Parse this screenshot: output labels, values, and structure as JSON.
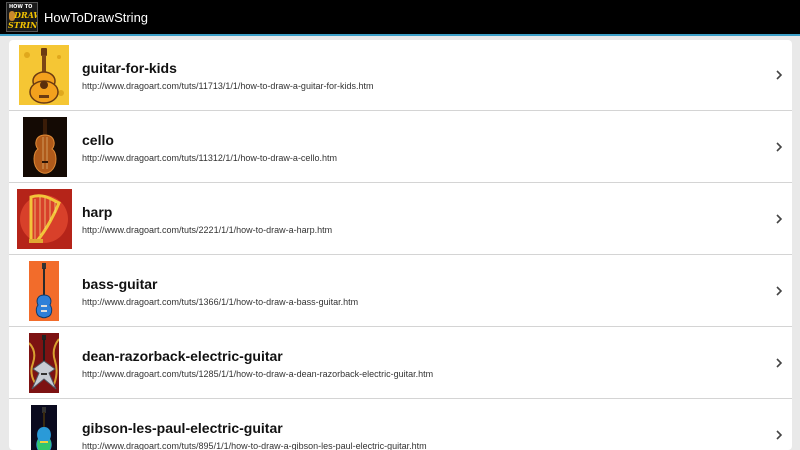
{
  "app": {
    "title": "HowToDrawString",
    "icon_text_top": "HOW TO",
    "icon_text_mid": "DRAW",
    "icon_text_bottom": "STRING"
  },
  "colors": {
    "action_bar": "#000000",
    "accent_line": "#3d9fc7",
    "background": "#e9e9e9"
  },
  "items": [
    {
      "title": "guitar-for-kids",
      "url": "http://www.dragoart.com/tuts/11713/1/1/how-to-draw-a-guitar-for-kids.htm",
      "icon": "acoustic-guitar-thumbnail"
    },
    {
      "title": "cello",
      "url": "http://www.dragoart.com/tuts/11312/1/1/how-to-draw-a-cello.htm",
      "icon": "cello-thumbnail"
    },
    {
      "title": "harp",
      "url": "http://www.dragoart.com/tuts/2221/1/1/how-to-draw-a-harp.htm",
      "icon": "harp-thumbnail"
    },
    {
      "title": "bass-guitar",
      "url": "http://www.dragoart.com/tuts/1366/1/1/how-to-draw-a-bass-guitar.htm",
      "icon": "bass-guitar-thumbnail"
    },
    {
      "title": "dean-razorback-electric-guitar",
      "url": "http://www.dragoart.com/tuts/1285/1/1/how-to-draw-a-dean-razorback-electric-guitar.htm",
      "icon": "dean-razorback-thumbnail"
    },
    {
      "title": "gibson-les-paul-electric-guitar",
      "url": "http://www.dragoart.com/tuts/895/1/1/how-to-draw-a-gibson-les-paul-electric-guitar.htm",
      "icon": "gibson-les-paul-thumbnail"
    }
  ]
}
